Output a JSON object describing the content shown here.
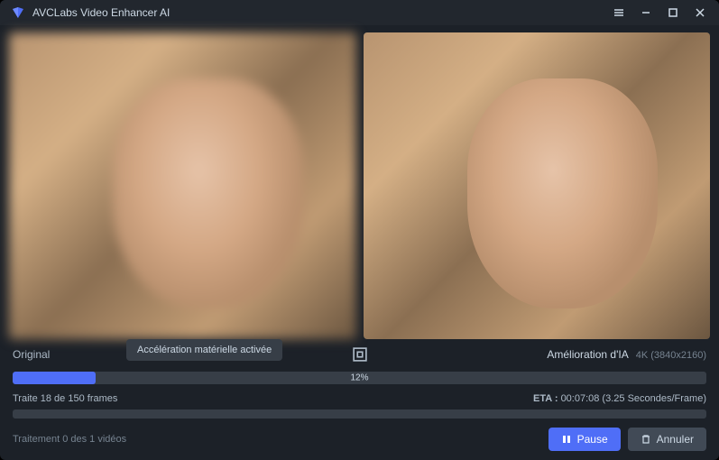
{
  "titlebar": {
    "app_name": "AVCLabs Video Enhancer AI"
  },
  "labels": {
    "original": "Original",
    "tooltip": "Accélération matérielle activée",
    "enhanced": "Amélioration d'IA",
    "resolution": "4K (3840x2160)"
  },
  "progress": {
    "percent_value": 12,
    "percent_label": "12%",
    "frames_status": "Traite 18 de 150 frames",
    "eta_label": "ETA :",
    "eta_value": "00:07:08 (3.25 Secondes/Frame)",
    "queue_status": "Traitement 0 des 1 vidéos"
  },
  "buttons": {
    "pause": "Pause",
    "cancel": "Annuler"
  },
  "colors": {
    "accent": "#4f6ef7",
    "bg_dark": "#1c2128",
    "bg_panel": "#373e47",
    "text_primary": "#cdd9e5",
    "text_secondary": "#768390"
  }
}
